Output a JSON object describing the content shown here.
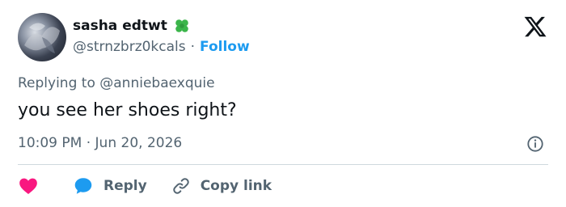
{
  "user": {
    "display_name": "sasha edtwt",
    "emoji_icon": "four-leaf-clover-icon",
    "handle": "@strnzbrz0kcals",
    "separator": "·",
    "follow_label": "Follow"
  },
  "reply_context": {
    "prefix": "Replying to",
    "mention": "@anniebaexquie"
  },
  "tweet": {
    "text": "you see her shoes right?",
    "time": "10:09 PM",
    "separator": "·",
    "date": "Jun 20, 2026"
  },
  "actions": {
    "like_icon": "heart-icon",
    "reply_label": "Reply",
    "copy_link_label": "Copy link"
  },
  "colors": {
    "accent": "#1d9bf0",
    "like": "#f91880",
    "text_primary": "#0f1419",
    "text_secondary": "#536471",
    "divider": "#cfd9de",
    "clover": "#3bb54a"
  },
  "icons": [
    "x-logo-icon",
    "info-icon",
    "heart-icon",
    "speech-bubble-icon",
    "link-icon",
    "four-leaf-clover-icon"
  ]
}
